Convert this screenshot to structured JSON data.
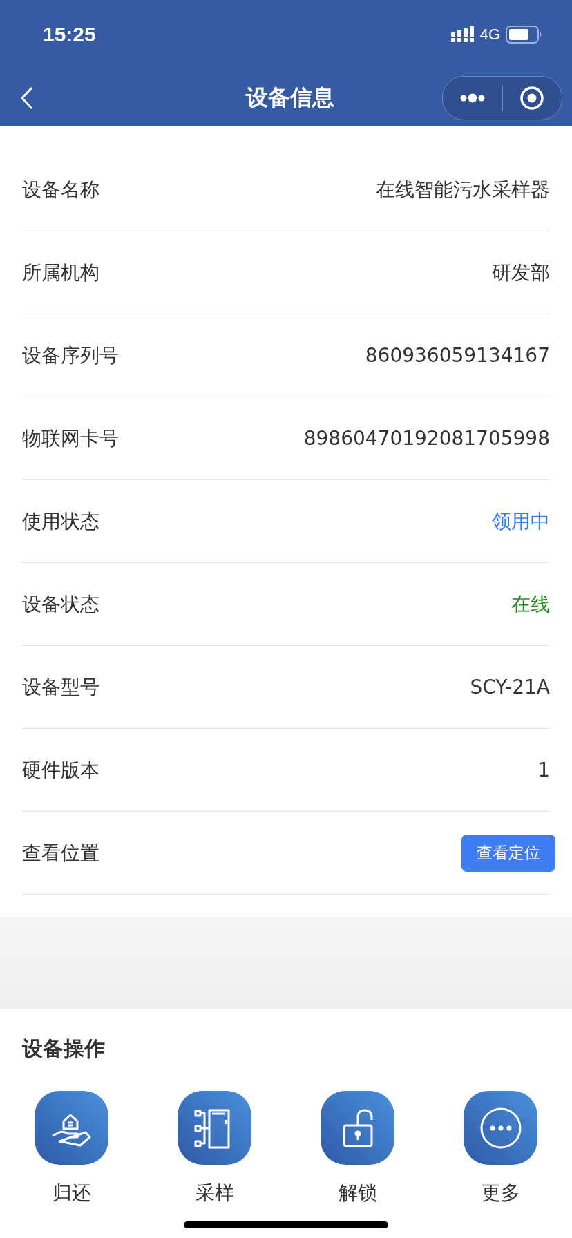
{
  "status_bar": {
    "time": "15:25",
    "network": "4G"
  },
  "nav_bar": {
    "title": "设备信息"
  },
  "info_rows": [
    {
      "label": "设备名称",
      "kind": "text",
      "value": "在线智能污水采样器"
    },
    {
      "label": "所属机构",
      "kind": "text",
      "value": "研发部"
    },
    {
      "label": "设备序列号",
      "kind": "text",
      "value": "860936059134167"
    },
    {
      "label": "物联网卡号",
      "kind": "text",
      "value": "89860470192081705998"
    },
    {
      "label": "使用状态",
      "kind": "text",
      "value": "领用中",
      "color": "#2e7cf6"
    },
    {
      "label": "设备状态",
      "kind": "text",
      "value": "在线",
      "color": "#2a8a22"
    },
    {
      "label": "设备型号",
      "kind": "text",
      "value": "SCY-21A"
    },
    {
      "label": "硬件版本",
      "kind": "text",
      "value": "1"
    },
    {
      "label": "查看位置",
      "kind": "button",
      "value": "查看定位"
    }
  ],
  "operations": {
    "title": "设备操作",
    "actions": [
      {
        "label": "归还"
      },
      {
        "label": "采样"
      },
      {
        "label": "解锁"
      },
      {
        "label": "更多"
      }
    ]
  }
}
